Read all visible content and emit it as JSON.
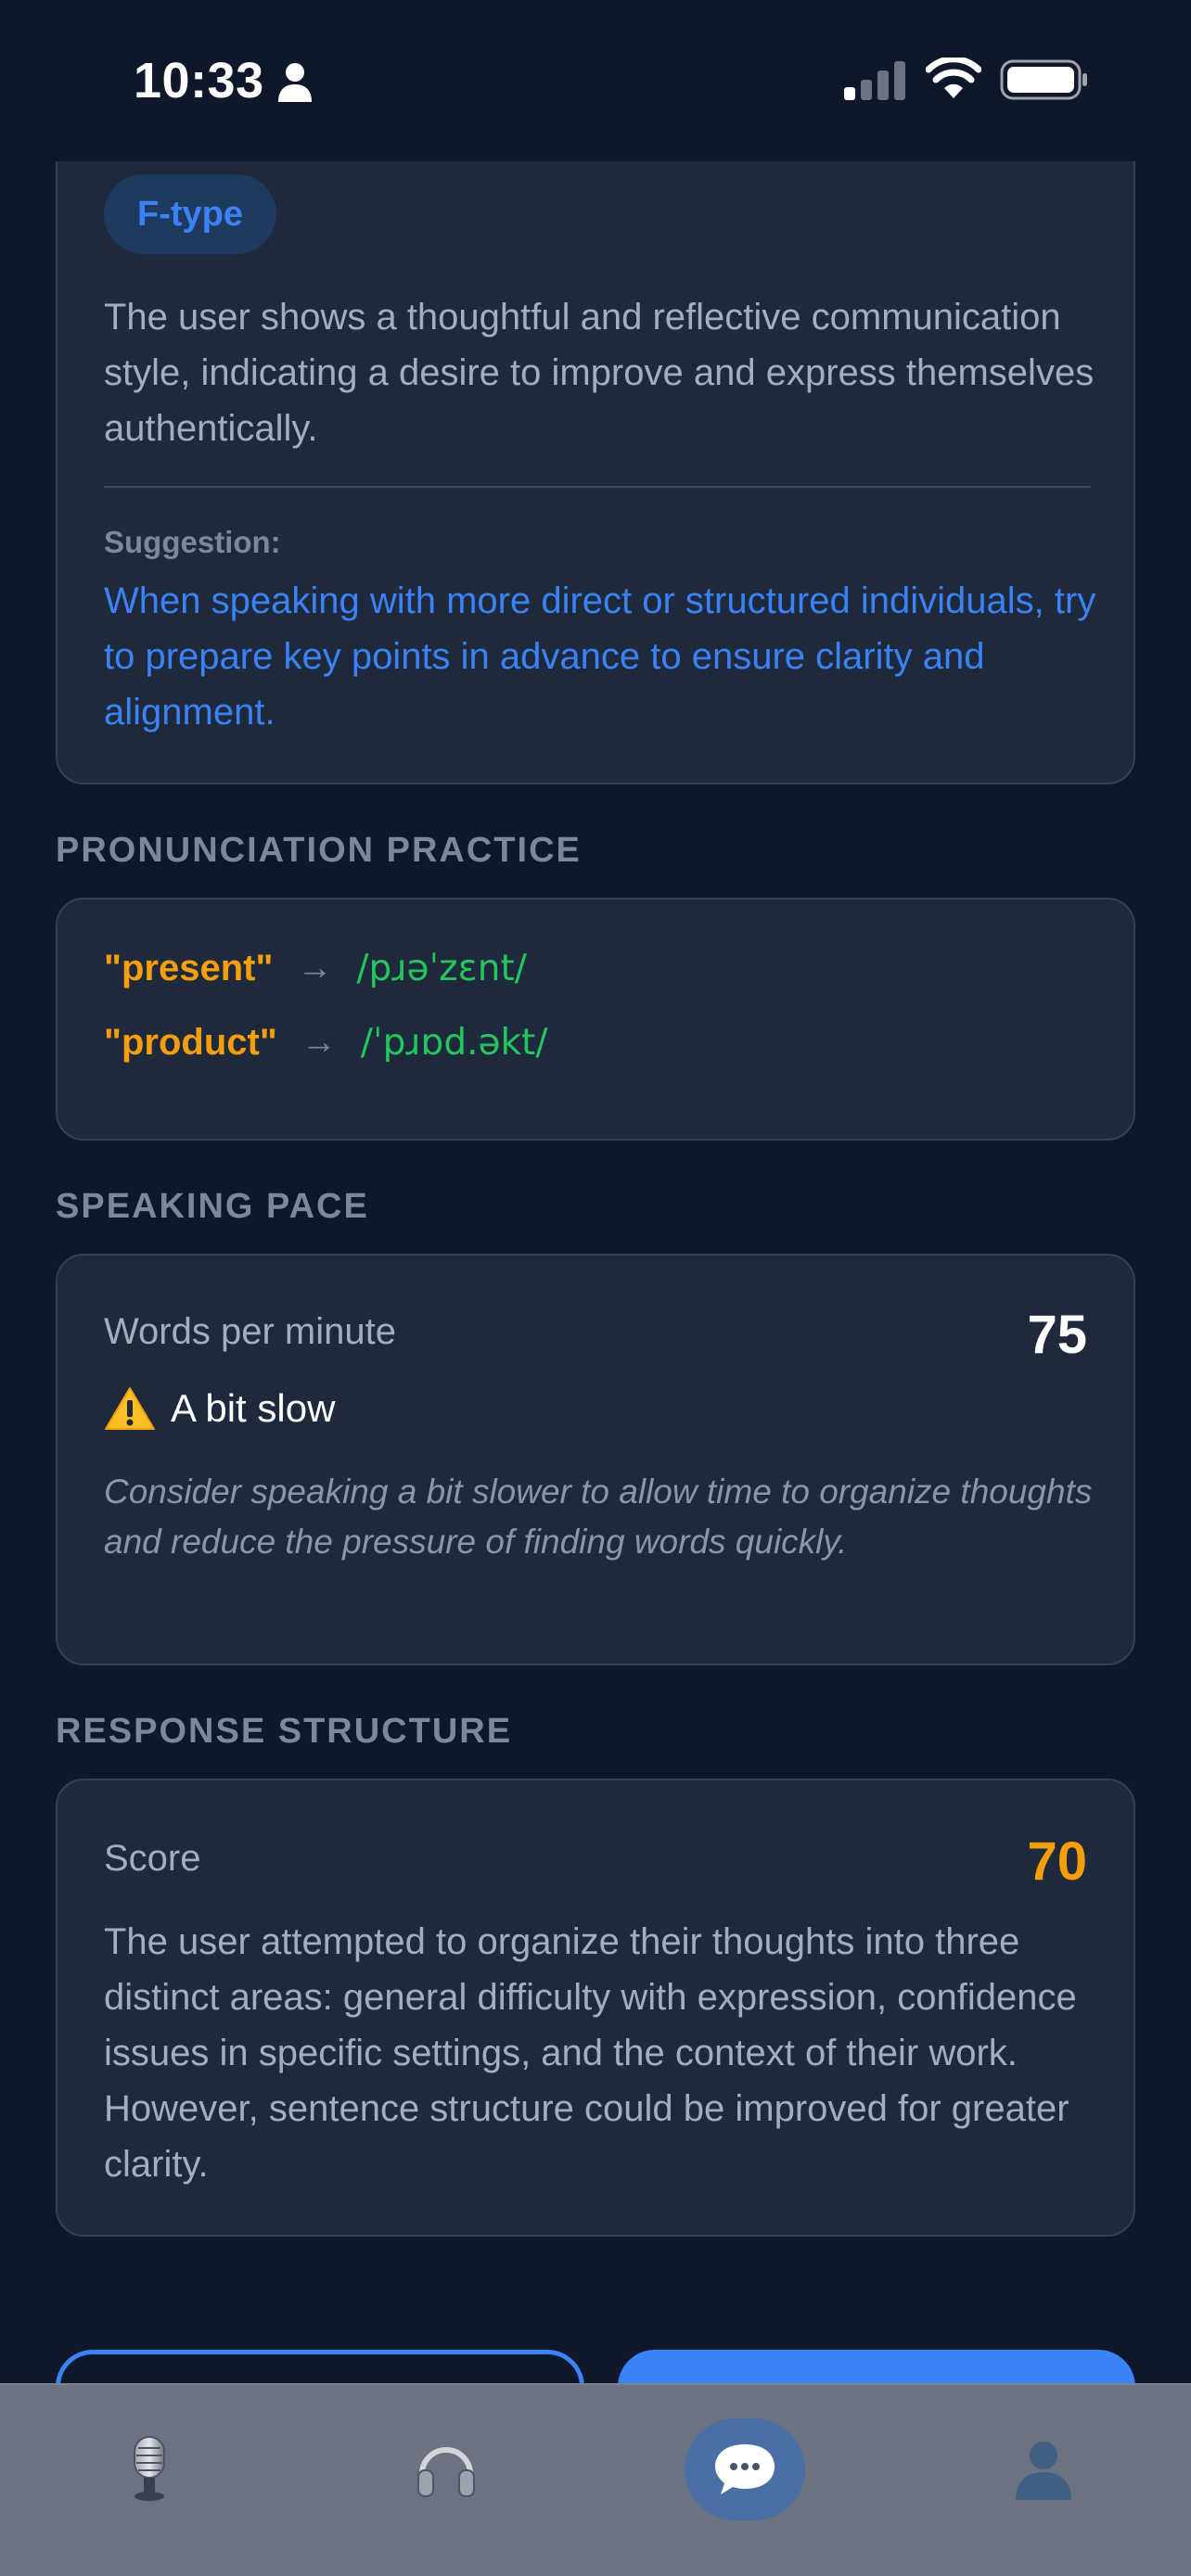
{
  "status_bar": {
    "time": "10:33",
    "icons": [
      "person-icon",
      "signal-icon",
      "wifi-icon",
      "battery-icon"
    ]
  },
  "personality": {
    "badge": "F-type",
    "description": "The user shows a thoughtful and reflective communication style, indicating a desire to improve and express themselves authentically.",
    "suggestion_label": "Suggestion:",
    "suggestion_text": "When speaking with more direct or structured individuals, try to prepare key points in advance to ensure clarity and alignment."
  },
  "pronunciation": {
    "title": "PRONUNCIATION PRACTICE",
    "items": [
      {
        "word": "\"present\"",
        "arrow": "→",
        "ipa": "/pɹəˈzɛnt/"
      },
      {
        "word": "\"product\"",
        "arrow": "→",
        "ipa": "/ˈpɹɒd.əkt/"
      }
    ]
  },
  "speaking_pace": {
    "title": "SPEAKING PACE",
    "label": "Words per minute",
    "value": "75",
    "status_icon": "warning-icon",
    "status": "A bit slow",
    "advice": "Consider speaking a bit slower to allow time to organize thoughts and reduce the pressure of finding words quickly."
  },
  "response_structure": {
    "title": "RESPONSE STRUCTURE",
    "score_label": "Score",
    "score": "70",
    "text": "The user attempted to organize their thoughts into three distinct areas: general difficulty with expression, confidence issues in specific settings, and the context of their work. However, sentence structure could be improved for greater clarity."
  },
  "tab_bar": {
    "tabs": [
      {
        "icon": "microphone-icon",
        "active": false
      },
      {
        "icon": "headphones-icon",
        "active": false
      },
      {
        "icon": "chat-bubble-icon",
        "active": true
      },
      {
        "icon": "profile-icon",
        "active": false
      }
    ]
  },
  "colors": {
    "background": "#0f172a",
    "card": "#1e293b",
    "accent_blue": "#3b82f6",
    "accent_orange": "#f59e0b",
    "accent_green": "#22c55e",
    "tab_bar": "#6b7280"
  }
}
